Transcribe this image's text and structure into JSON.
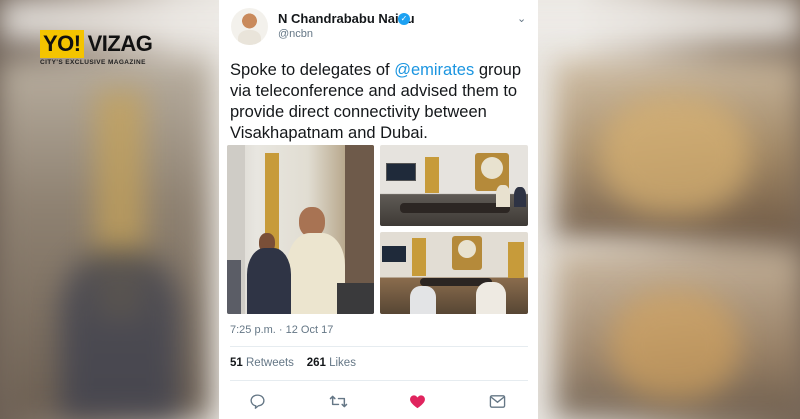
{
  "logo": {
    "brand_left": "YO!",
    "brand_right": "VIZAG",
    "tagline": "CITY'S EXCLUSIVE MAGAZINE"
  },
  "tweet": {
    "author_name": "N Chandrababu Naidu",
    "handle": "@ncbn",
    "text_before": "Spoke to delegates of ",
    "mention": "@emirates",
    "text_after": " group via teleconference and advised them to provide direct connectivity between Visakhapatnam and Dubai.",
    "timestamp": "7:25 p.m. · 12 Oct 17",
    "retweets_count": "51",
    "retweets_label": "Retweets",
    "likes_count": "261",
    "likes_label": "Likes"
  },
  "icons": [
    "verified-badge-icon",
    "caret-down-icon",
    "reply-icon",
    "retweet-icon",
    "like-heart-icon",
    "direct-message-icon"
  ],
  "colors": {
    "link": "#1b95e0",
    "verified": "#1da1f2",
    "like": "#e0245e",
    "logo_yellow": "#f4c400"
  }
}
